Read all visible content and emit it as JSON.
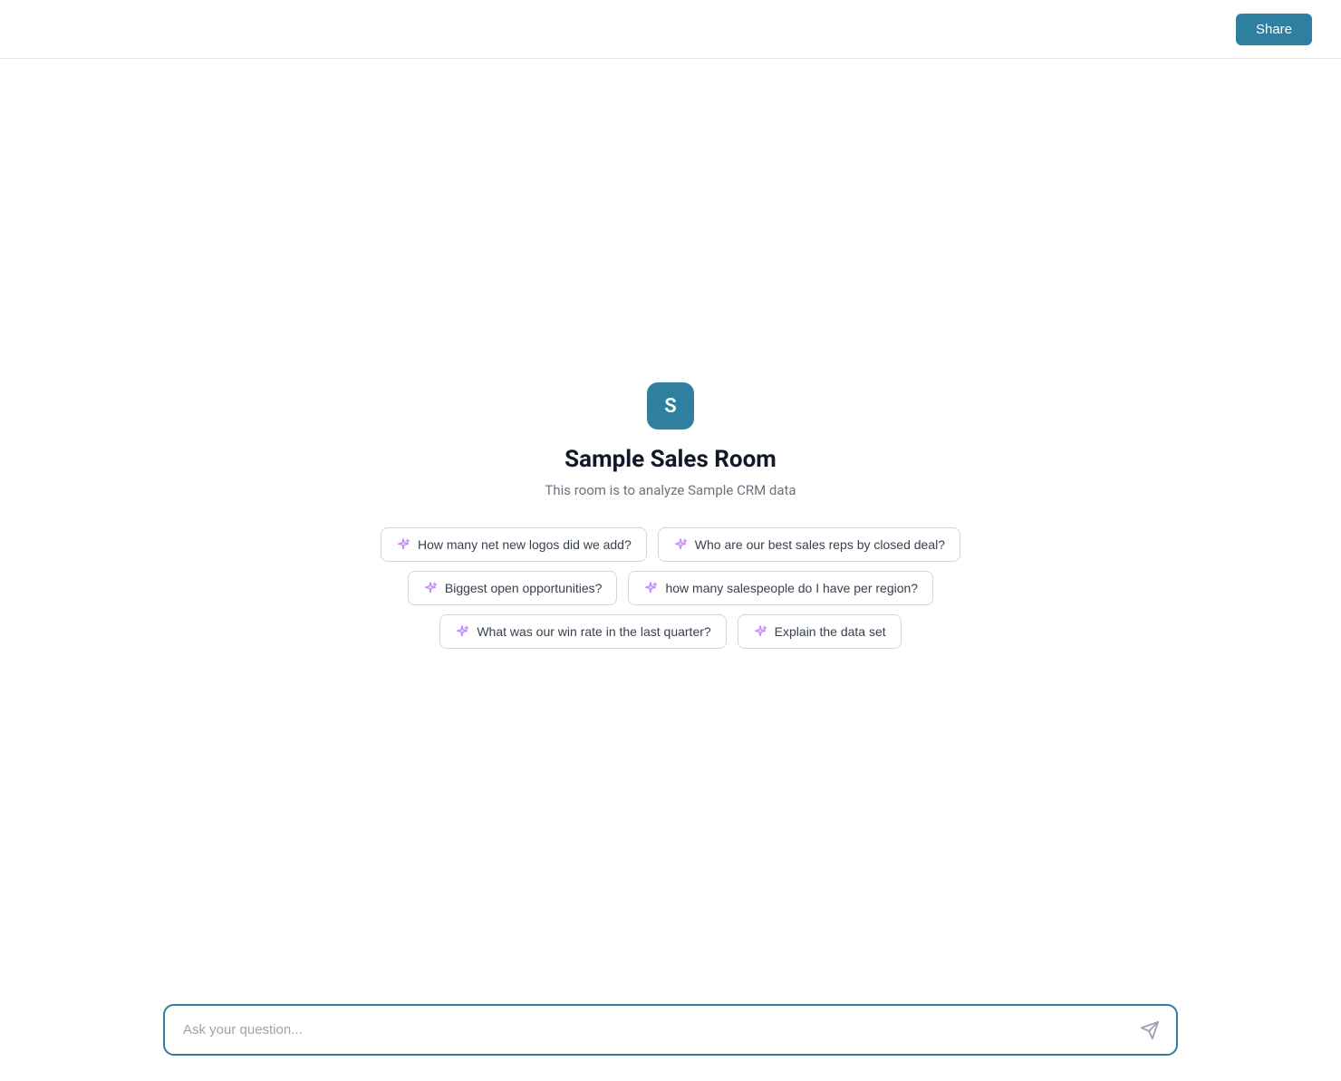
{
  "header": {
    "share_label": "Share"
  },
  "room": {
    "icon_letter": "S",
    "title": "Sample Sales Room",
    "subtitle": "This room is to analyze Sample CRM data"
  },
  "suggestions": {
    "row1": [
      {
        "id": "net-logos",
        "label": "How many net new logos did we add?"
      },
      {
        "id": "best-reps",
        "label": "Who are our best sales reps by closed deal?"
      }
    ],
    "row2": [
      {
        "id": "open-opps",
        "label": "Biggest open opportunities?"
      },
      {
        "id": "salespeople-region",
        "label": "how many salespeople do I have per region?"
      }
    ],
    "row3": [
      {
        "id": "win-rate",
        "label": "What was our win rate in the last quarter?"
      },
      {
        "id": "explain-data",
        "label": "Explain the data set"
      }
    ]
  },
  "input": {
    "placeholder": "Ask your question..."
  }
}
